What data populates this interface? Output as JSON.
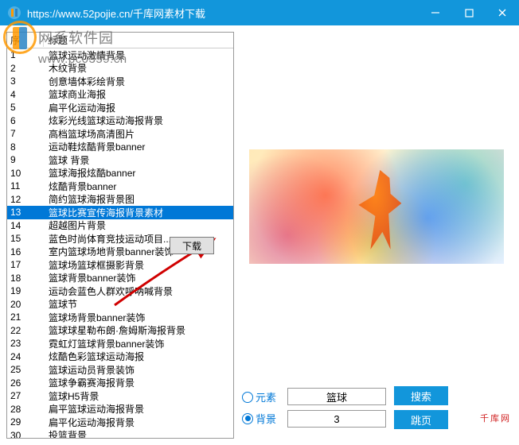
{
  "titlebar": {
    "url": "https://www.52pojie.cn/千库网素材下载"
  },
  "watermark": {
    "site_name": "网系软件园",
    "site_url": "www.pc0359.cn"
  },
  "list": {
    "header_seq": "序",
    "header_title": "标题",
    "selected_index": 13,
    "rows": [
      {
        "n": "1",
        "t": "篮球运动激情背景"
      },
      {
        "n": "2",
        "t": "木纹背景"
      },
      {
        "n": "3",
        "t": "创意墙体彩绘背景"
      },
      {
        "n": "4",
        "t": "篮球商业海报"
      },
      {
        "n": "5",
        "t": "扁平化运动海报"
      },
      {
        "n": "6",
        "t": "炫彩光线篮球运动海报背景"
      },
      {
        "n": "7",
        "t": "高档篮球场高清图片"
      },
      {
        "n": "8",
        "t": "运动鞋炫酷背景banner"
      },
      {
        "n": "9",
        "t": "篮球 背景"
      },
      {
        "n": "10",
        "t": "篮球海报炫酷banner"
      },
      {
        "n": "11",
        "t": "炫酷背景banner"
      },
      {
        "n": "12",
        "t": "简约篮球海报背景图"
      },
      {
        "n": "13",
        "t": "篮球比赛宣传海报背景素材"
      },
      {
        "n": "14",
        "t": "超越图片背景"
      },
      {
        "n": "15",
        "t": "蓝色时尚体育竞技运动项目..."
      },
      {
        "n": "16",
        "t": "室内篮球场地背景banner装饰"
      },
      {
        "n": "17",
        "t": "篮球场篮球框摄影背景"
      },
      {
        "n": "18",
        "t": "篮球背景banner装饰"
      },
      {
        "n": "19",
        "t": "运动会蓝色人群欢呼呐喊背景"
      },
      {
        "n": "20",
        "t": "篮球节"
      },
      {
        "n": "21",
        "t": "篮球场背景banner装饰"
      },
      {
        "n": "22",
        "t": "篮球球星勒布朗·詹姆斯海报背景"
      },
      {
        "n": "23",
        "t": "霓虹灯篮球背景banner装饰"
      },
      {
        "n": "24",
        "t": "炫酷色彩篮球运动海报"
      },
      {
        "n": "25",
        "t": "篮球运动员背景装饰"
      },
      {
        "n": "26",
        "t": "篮球争霸赛海报背景"
      },
      {
        "n": "27",
        "t": "篮球H5背景"
      },
      {
        "n": "28",
        "t": "扁平篮球运动海报背景"
      },
      {
        "n": "29",
        "t": "扁平化运动海报背景"
      },
      {
        "n": "30",
        "t": "投篮背景"
      }
    ]
  },
  "context_menu": {
    "download_label": "下载"
  },
  "controls": {
    "radio_element": "元素",
    "radio_background": "背景",
    "radio_selected": "background",
    "search_value": "篮球",
    "page_value": "3",
    "search_btn": "搜索",
    "jump_btn": "跳页"
  },
  "brand_text": "千库网"
}
